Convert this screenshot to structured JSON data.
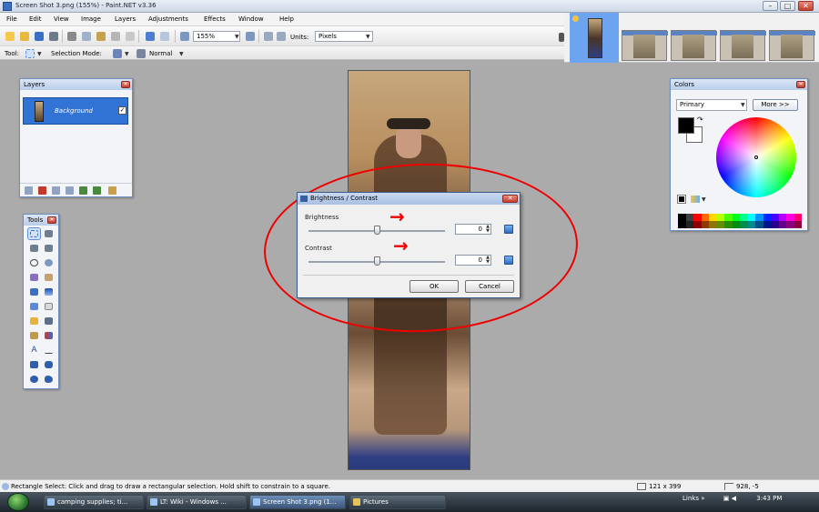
{
  "window": {
    "title": "Screen Shot 3.png (155%) - Paint.NET v3.36",
    "min": "–",
    "max": "□",
    "close": "✕"
  },
  "menu": [
    "File",
    "Edit",
    "View",
    "Image",
    "Layers",
    "Adjustments",
    "Effects",
    "Window",
    "Help"
  ],
  "toolbar": {
    "zoom": "155%",
    "units_label": "Units:",
    "units_value": "Pixels",
    "tool_label": "Tool:",
    "selection_mode_label": "Selection Mode:",
    "blend_mode": "Normal"
  },
  "layers_panel": {
    "title": "Layers",
    "layer_name": "Background",
    "checked": "✓"
  },
  "tools_panel": {
    "title": "Tools"
  },
  "colors_panel": {
    "title": "Colors",
    "primary_select": "Primary",
    "more_button": "More >>"
  },
  "dialog": {
    "title": "Brightness / Contrast",
    "brightness_label": "Brightness",
    "brightness_value": "0",
    "brightness_level": 0.5,
    "contrast_label": "Contrast",
    "contrast_value": "0",
    "contrast_level": 0.5,
    "ok": "OK",
    "cancel": "Cancel"
  },
  "annotation_arrows": [
    "→",
    "→"
  ],
  "status": {
    "text": "Rectangle Select: Click and drag to draw a rectangular selection. Hold shift to constrain to a square.",
    "size": "121 x 399",
    "cursor": "928, -5"
  },
  "taskbar": {
    "tasks": [
      "camping supplies; ti...",
      "LT: Wiki - Windows ...",
      "Screen Shot 3.png (1...",
      "Pictures"
    ],
    "links": "Links",
    "clock": "3:43 PM"
  },
  "colors": {
    "accent": "#3273d6",
    "annotation": "#e00000",
    "palette": [
      "#000000",
      "#404040",
      "#ff0000",
      "#ff6a00",
      "#ffd800",
      "#b6ff00",
      "#4cff00",
      "#00ff21",
      "#00ff90",
      "#00ffff",
      "#0094ff",
      "#0026ff",
      "#4800ff",
      "#b200ff",
      "#ff00dc",
      "#ff006e"
    ]
  }
}
